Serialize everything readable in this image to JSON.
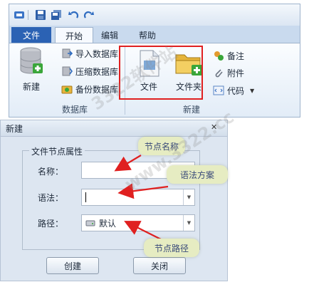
{
  "ribbon": {
    "tabs": {
      "file": "文件",
      "home": "开始",
      "edit": "编辑",
      "help": "帮助"
    },
    "db_group": {
      "new_label": "新建",
      "import_label": "导入数据库",
      "compress_label": "压缩数据库",
      "backup_label": "备份数据库",
      "group_label": "数据库"
    },
    "new_group": {
      "file_label": "文件",
      "folder_label": "文件夹",
      "note_label": "备注",
      "attach_label": "附件",
      "code_label": "代码",
      "group_label": "新建"
    }
  },
  "dialog": {
    "title": "新建",
    "close_glyph": "✕",
    "fieldset_title": "文件节点属性",
    "name_label": "名称：",
    "name_value": "",
    "syntax_label": "语法：",
    "syntax_value": "",
    "path_label": "路径：",
    "path_value": "默认",
    "create_label": "创建",
    "close_label": "关闭"
  },
  "annotations": {
    "name_callout": "节点名称",
    "syntax_callout": "语法方案",
    "path_callout": "节点路径"
  },
  "watermark": {
    "text1": "3322软件站",
    "text2": "www.3322.cc"
  },
  "colors": {
    "file_tab": "#2b62b4",
    "highlight": "#e02020",
    "arrow": "#e02020",
    "callout_bg": "#e6ecc2"
  }
}
